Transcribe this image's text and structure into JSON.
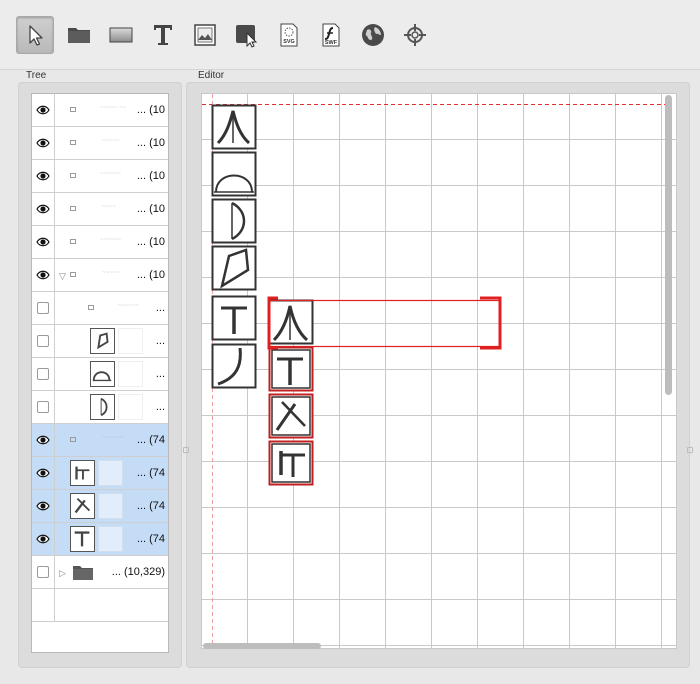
{
  "toolbar": {
    "tools": [
      {
        "name": "select-arrow-tool",
        "icon": "arrow-pointer-icon",
        "active": true
      },
      {
        "name": "folder-tool",
        "icon": "folder-icon",
        "active": false
      },
      {
        "name": "rectangle-tool",
        "icon": "rectangle-icon",
        "active": false
      },
      {
        "name": "text-tool",
        "icon": "text-t-icon",
        "active": false
      },
      {
        "name": "image-tool",
        "icon": "image-icon",
        "active": false
      },
      {
        "name": "link-tool",
        "icon": "cursor-box-icon",
        "active": false
      },
      {
        "name": "svg-file-tool",
        "icon": "svg-file-icon",
        "active": false,
        "label": "SVG"
      },
      {
        "name": "swf-file-tool",
        "icon": "swf-file-icon",
        "active": false,
        "label": "SWF"
      },
      {
        "name": "web-tool",
        "icon": "globe-icon",
        "active": false
      },
      {
        "name": "target-tool",
        "icon": "crosshair-icon",
        "active": false
      }
    ]
  },
  "tree": {
    "label": "Tree",
    "rows": [
      {
        "visible": true,
        "label": "... (10",
        "selected": false
      },
      {
        "visible": true,
        "label": "... (10",
        "selected": false
      },
      {
        "visible": true,
        "label": "... (10",
        "selected": false
      },
      {
        "visible": true,
        "label": "... (10",
        "selected": false
      },
      {
        "visible": true,
        "label": "... (10",
        "selected": false
      },
      {
        "visible": true,
        "label": "... (10",
        "selected": false,
        "expanded": true
      },
      {
        "visible": false,
        "label": "...",
        "selected": false
      },
      {
        "visible": false,
        "label": "...",
        "selected": false
      },
      {
        "visible": false,
        "label": "...",
        "selected": false
      },
      {
        "visible": false,
        "label": "...",
        "selected": false
      },
      {
        "visible": true,
        "label": "... (74",
        "selected": true
      },
      {
        "visible": true,
        "label": "... (74",
        "selected": true
      },
      {
        "visible": true,
        "label": "... (74",
        "selected": true
      },
      {
        "visible": true,
        "label": "... (74",
        "selected": true
      },
      {
        "visible": false,
        "label": "... (10,329)",
        "selected": false,
        "folder": true
      }
    ]
  },
  "editor": {
    "label": "Editor",
    "selection_color": "#e02020",
    "guide_color": "#e03030",
    "grid_color": "#c9c9c9"
  }
}
